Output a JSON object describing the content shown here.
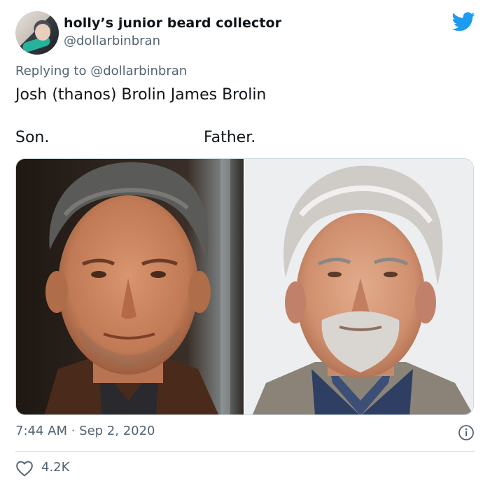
{
  "tweet": {
    "display_name": "holly’s junior beard collector",
    "handle": "@dollarbinbran",
    "replying_prefix": "Replying to ",
    "replying_to": "@dollarbinbran",
    "text": "Josh (thanos) Brolin James Brolin",
    "label_left": "Son.",
    "label_right": "Father.",
    "timestamp": "7:44 AM · Sep 2, 2020",
    "like_count": "4.2K"
  },
  "icons": {
    "brand": "twitter-bird-icon",
    "info": "info-icon",
    "like": "heart-icon"
  },
  "colors": {
    "brand_blue": "#1d9bf0",
    "secondary_text": "#536471",
    "primary_text": "#0f1419",
    "border": "#cfd9de"
  }
}
